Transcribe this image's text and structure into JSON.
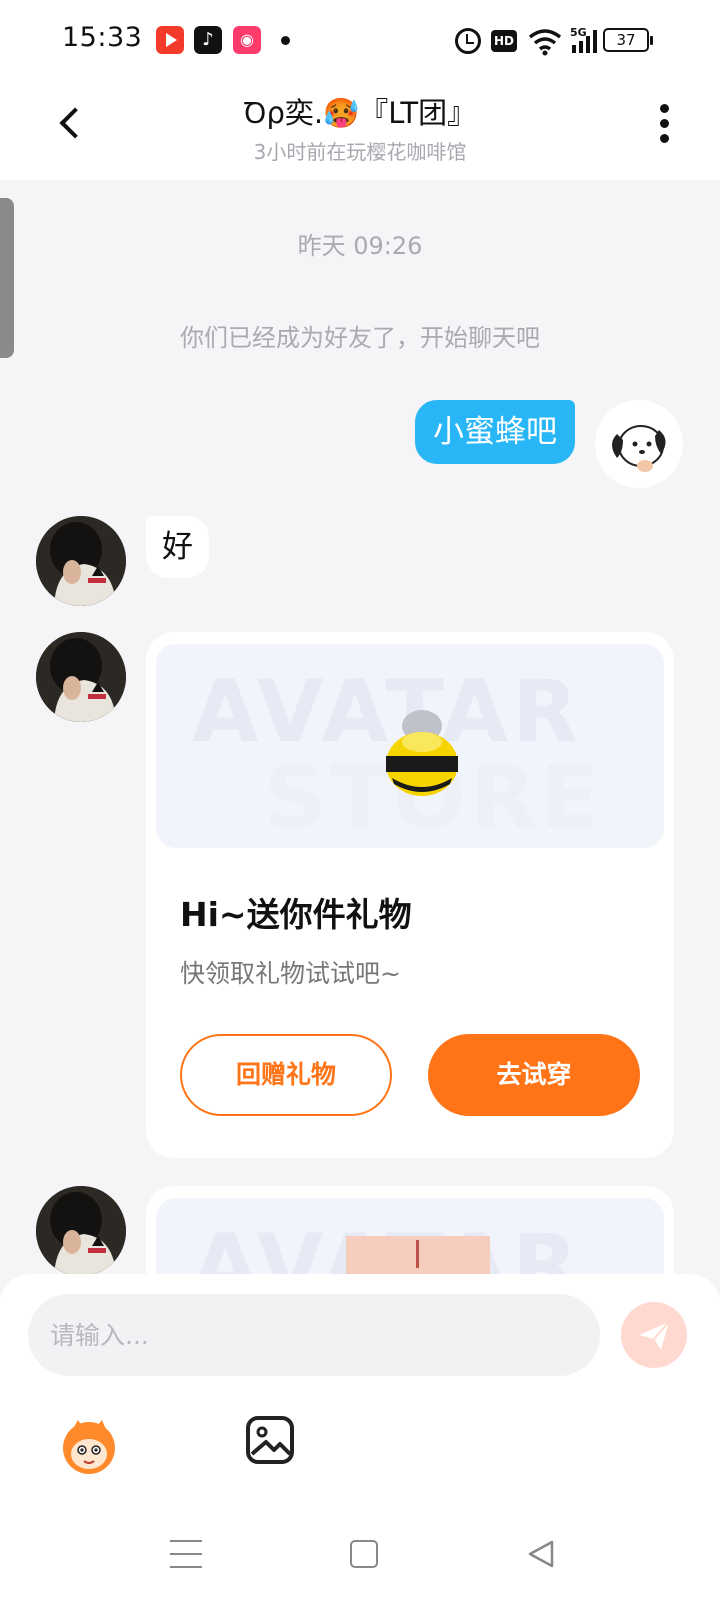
{
  "status_bar": {
    "time": "15:33",
    "battery": "37",
    "app_icons": [
      "video-app-icon",
      "tiktok-icon",
      "kuaishou-icon"
    ],
    "indicators": [
      "alarm-icon",
      "hd-icon",
      "wifi-icon",
      "signal-5g-icon",
      "battery-icon"
    ]
  },
  "header": {
    "title": "Ꝺρ奕.🥵『LT团』",
    "subtitle": "3小时前在玩樱花咖啡馆"
  },
  "chat": {
    "timestamp": "昨天 09:26",
    "system_message": "你们已经成为好友了，开始聊天吧",
    "messages": [
      {
        "from": "self",
        "text": "小蜜蜂吧"
      },
      {
        "from": "friend",
        "text": "好"
      }
    ],
    "gift_card": {
      "banner_words": [
        "AVATAR",
        "STORE"
      ],
      "title": "Hi~送你件礼物",
      "description": "快领取礼物试试吧~",
      "return_gift_label": "回赠礼物",
      "try_on_label": "去试穿"
    },
    "gift_card_2": {
      "banner_words": [
        "AVATAR"
      ]
    }
  },
  "input": {
    "placeholder": "请输入..."
  },
  "colors": {
    "accent_orange": "#ff7417",
    "bubble_blue": "#29b6f6",
    "background": "#f5f5f7"
  }
}
